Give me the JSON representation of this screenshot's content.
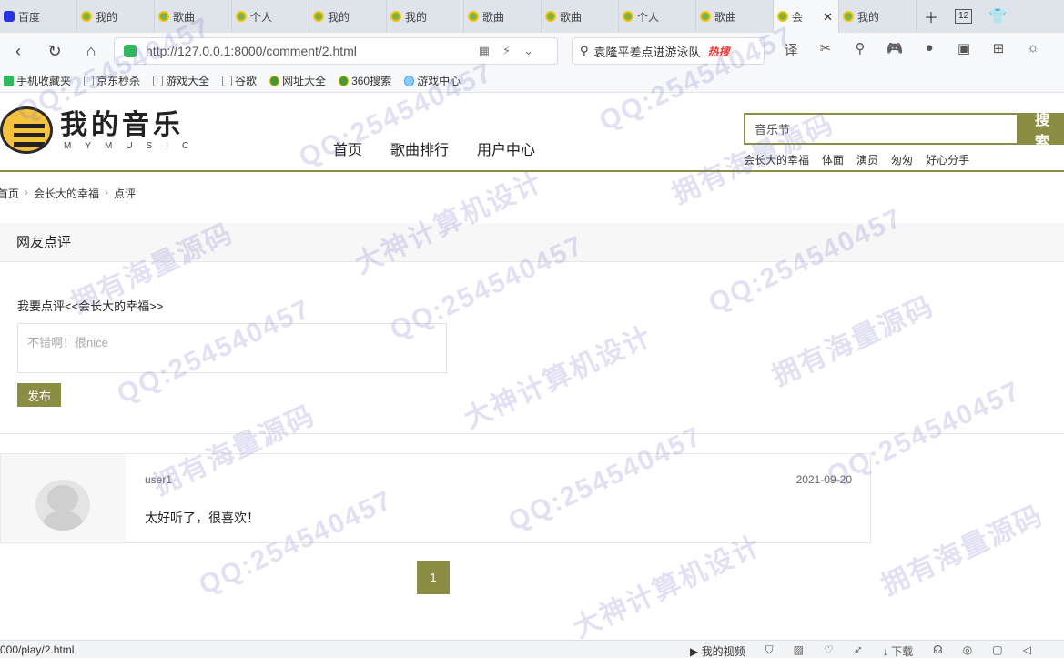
{
  "browser": {
    "tabs": [
      {
        "label": "百度",
        "icon": "baidu-icon"
      },
      {
        "label": "我的",
        "icon": "music-icon"
      },
      {
        "label": "歌曲",
        "icon": "music-icon"
      },
      {
        "label": "个人",
        "icon": "music-icon"
      },
      {
        "label": "我的",
        "icon": "music-icon"
      },
      {
        "label": "我的",
        "icon": "music-icon"
      },
      {
        "label": "歌曲",
        "icon": "music-icon"
      },
      {
        "label": "歌曲",
        "icon": "music-icon"
      },
      {
        "label": "个人",
        "icon": "music-icon"
      },
      {
        "label": "歌曲",
        "icon": "music-icon"
      },
      {
        "label": "会",
        "icon": "music-icon",
        "active": true
      },
      {
        "label": "我的",
        "icon": "music-icon"
      }
    ],
    "tab_count": "12",
    "url": "http://127.0.0.1:8000/comment/2.html",
    "search_value": "袁隆平差点进游泳队",
    "search_hot": "热搜",
    "bookmarks": [
      "手机收藏夹",
      "京东秒杀",
      "游戏大全",
      "谷歌",
      "网址大全",
      "360搜索",
      "游戏中心"
    ]
  },
  "site": {
    "logo_cn": "我的音乐",
    "logo_en": "MYMUSIC",
    "nav": [
      "首页",
      "歌曲排行",
      "用户中心"
    ],
    "search_value": "音乐节",
    "search_button": "搜 索",
    "hot_words": [
      "会长大的幸福",
      "体面",
      "演员",
      "匆匆",
      "好心分手"
    ],
    "accent_color": "#8c8d45"
  },
  "breadcrumb": [
    "首页",
    "会长大的幸福",
    "点评"
  ],
  "comments": {
    "panel_title": "网友点评",
    "form_label": "我要点评<<会长大的幸福>>",
    "input_placeholder": "不错啊！很nice",
    "publish_button": "发布",
    "items": [
      {
        "user": "user1",
        "date": "2021-09-20",
        "text": "太好听了，很喜欢！"
      }
    ],
    "current_page": "1"
  },
  "statusbar": {
    "url": "000/play/2.html",
    "items": [
      "我的视频",
      "下载"
    ]
  },
  "watermark": [
    "QQ:254540457",
    "拥有海量源码",
    "大神计算机设计"
  ]
}
